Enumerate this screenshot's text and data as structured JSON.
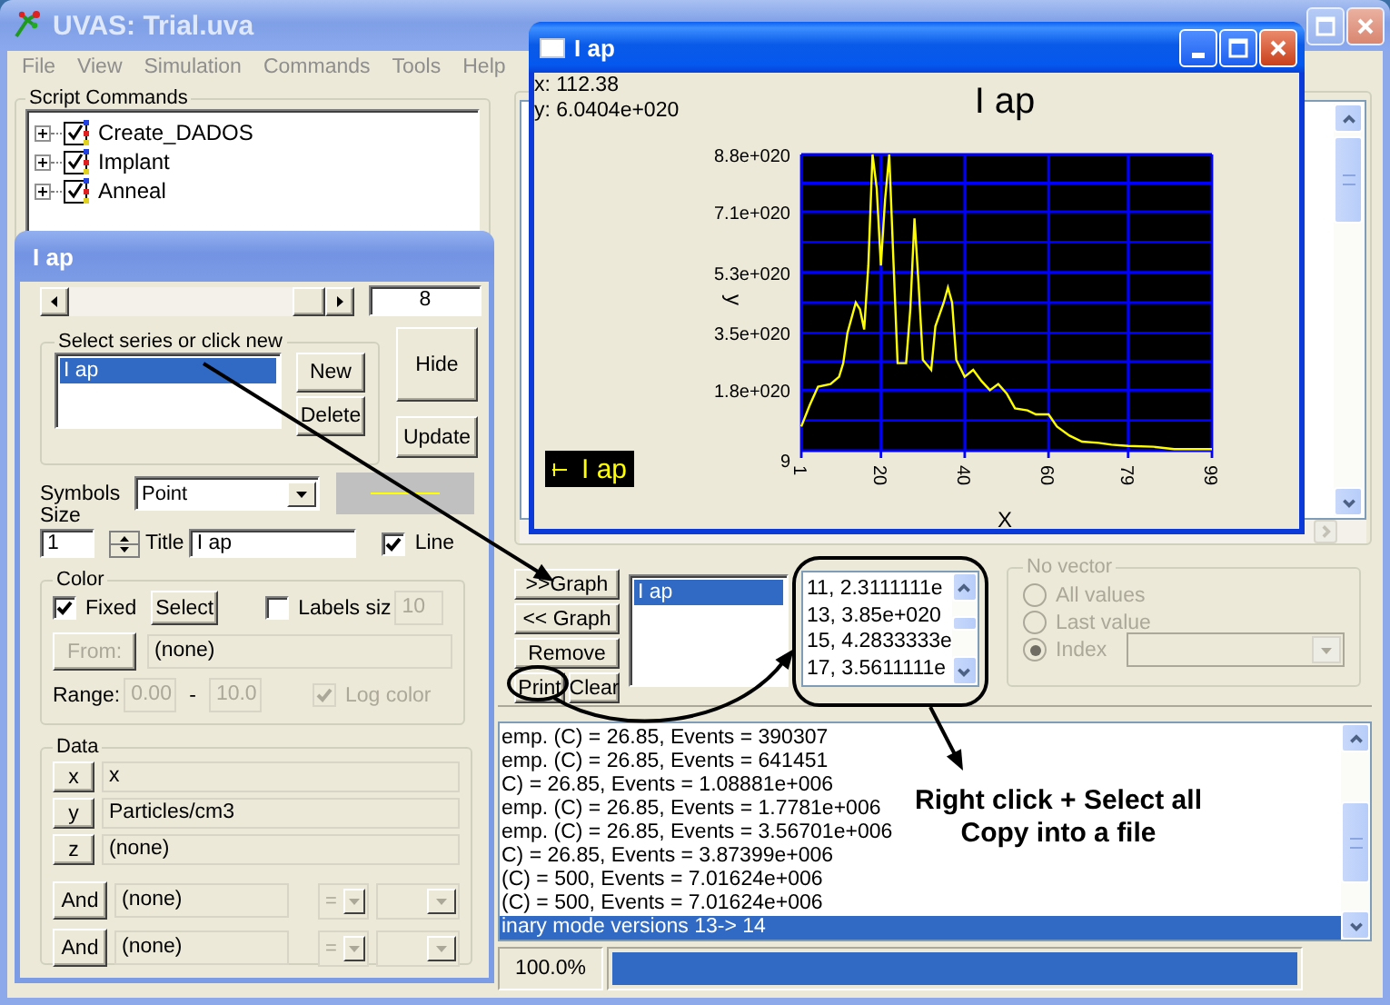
{
  "main_window": {
    "title": "UVAS: Trial.uva"
  },
  "menu": [
    "File",
    "View",
    "Simulation",
    "Commands",
    "Tools",
    "Help"
  ],
  "script_commands": {
    "title": "Script Commands",
    "items": [
      {
        "label": "Create_DADOS",
        "expanded": false
      },
      {
        "label": "Implant",
        "expanded": false
      },
      {
        "label": "Anneal",
        "expanded": false
      }
    ]
  },
  "plot_panel": {
    "buttons": [
      ">>Graph",
      "<< Graph",
      "Remove",
      "Print",
      "Clear"
    ],
    "graphs": [
      {
        "label": "I ap",
        "selected": true
      }
    ],
    "values": [
      "11, 2.3111111e",
      "13, 3.85e+020",
      "15, 4.2833333e",
      "17, 3.5611111e"
    ]
  },
  "no_vector": {
    "title": "No vector",
    "options": [
      {
        "label": "All values",
        "selected": false
      },
      {
        "label": "Last value",
        "selected": false
      },
      {
        "label": "Index",
        "selected": true
      }
    ]
  },
  "log": {
    "lines": [
      {
        "text": "emp. (C) = 26.85, Events = 390307",
        "selected": false
      },
      {
        "text": "emp. (C) = 26.85, Events = 641451",
        "selected": false
      },
      {
        "text": "C) = 26.85, Events = 1.08881e+006",
        "selected": false
      },
      {
        "text": "emp. (C) = 26.85, Events = 1.7781e+006",
        "selected": false
      },
      {
        "text": "emp. (C) = 26.85, Events = 3.56701e+006",
        "selected": false
      },
      {
        "text": "C) = 26.85, Events = 3.87399e+006",
        "selected": false
      },
      {
        "text": "(C) = 500, Events = 7.01624e+006",
        "selected": false
      },
      {
        "text": "(C) = 500, Events = 7.01624e+006",
        "selected": false
      },
      {
        "text": "inary mode versions 13-> 14",
        "selected": true
      }
    ]
  },
  "status_bar": {
    "percent": "100.0%",
    "progress": {
      "level": 1
    }
  },
  "series_dialog": {
    "title": "I ap",
    "page": "8",
    "group_title": "Select series or click new",
    "series": [
      {
        "label": "I ap",
        "selected": true
      }
    ],
    "new": "New",
    "delete": "Delete",
    "hide": "Hide",
    "update": "Update",
    "symbols_label": "Symbols",
    "symbol": "Point",
    "size_label": "Size",
    "size": "1",
    "title_label": "Title",
    "title_value": "I ap",
    "line": {
      "label": "Line",
      "checked": true
    },
    "color": {
      "title": "Color",
      "fixed": {
        "label": "Fixed",
        "checked": true
      },
      "select": "Select",
      "labels_size": {
        "label": "Labels siz",
        "checked": false
      },
      "labels_size_value": {
        "text": "10",
        "disabled": true
      },
      "from": {
        "text": "From:",
        "disabled": true
      },
      "from_value": "(none)",
      "range_label": "Range:",
      "range_min": {
        "text": "0.00",
        "disabled": true
      },
      "range_separator": "-",
      "range_max": {
        "text": "10.0",
        "disabled": true
      },
      "log_color": {
        "label": "Log color",
        "checked": true,
        "disabled": true
      }
    },
    "data": {
      "title": "Data",
      "axes": [
        {
          "button": "x",
          "value": "x"
        },
        {
          "button": "y",
          "value": "Particles/cm3"
        },
        {
          "button": "z",
          "value": "(none)"
        }
      ],
      "filters": [
        {
          "button": "And",
          "value": "(none)",
          "operator": "=",
          "disabled": true
        },
        {
          "button": "And",
          "value": "(none)",
          "operator": "=",
          "disabled": true
        }
      ]
    }
  },
  "graph_window": {
    "title": "I ap",
    "cursor_x": "x: 112.38",
    "cursor_y": "y: 6.0404e+020",
    "chart_data": {
      "type": "line",
      "grid": true,
      "title": "I ap",
      "xlabel": "X",
      "ylabel": "y",
      "x": [
        1,
        3,
        5,
        8,
        10,
        11,
        12,
        14,
        15,
        16,
        17,
        18,
        19,
        20,
        21,
        22,
        23,
        24,
        26,
        27,
        28,
        29,
        30,
        32,
        33,
        35,
        36,
        37,
        38,
        40,
        42,
        44,
        46,
        48,
        50,
        52,
        55,
        57,
        60,
        62,
        65,
        68,
        72,
        75,
        79,
        85,
        90,
        99
      ],
      "series": [
        {
          "name": "I ap",
          "color": "#ffff00",
          "values": [
            7.2e+19,
            1.35e+20,
            1.9e+20,
            1.98e+20,
            2.2e+20,
            2.6e+20,
            3.5e+20,
            4.4e+20,
            4.2e+20,
            3.6e+20,
            5.5e+20,
            8.8e+20,
            7.8e+20,
            5.5e+20,
            7.45e+20,
            8.8e+20,
            5.65e+20,
            2.6e+20,
            2.6e+20,
            4.2e+20,
            6.9e+20,
            4.9e+20,
            2.7e+20,
            2.4e+20,
            3.7e+20,
            4.4e+20,
            4.85e+20,
            4.4e+20,
            2.7e+20,
            2.2e+20,
            2.4e+20,
            2.07e+20,
            1.8e+20,
            1.98e+20,
            1.7e+20,
            1.26e+20,
            1.2e+20,
            1.08e+20,
            1.08e+20,
            7.2e+19,
            4.5e+19,
            2.7e+19,
            2.3e+19,
            1.8e+19,
            1.4e+19,
            1.2e+19,
            5e+18,
            5e+18
          ]
        }
      ],
      "xlim": [
        1,
        99
      ],
      "ylim": [
        9,
        8.8e+20
      ],
      "xticks": [
        1,
        20,
        40,
        60,
        79,
        99
      ],
      "yticks": [
        {
          "value": 9,
          "label": "9"
        },
        {
          "value": 1.8e+20,
          "label": "1.8e+020"
        },
        {
          "value": 3.5e+20,
          "label": "3.5e+020"
        },
        {
          "value": 5.3e+20,
          "label": "5.3e+020"
        },
        {
          "value": 7.1e+20,
          "label": "7.1e+020"
        },
        {
          "value": 8.8e+20,
          "label": "8.8e+020"
        }
      ]
    }
  },
  "annotation": {
    "lines": [
      "Right click + Select all",
      "Copy into a file"
    ]
  }
}
